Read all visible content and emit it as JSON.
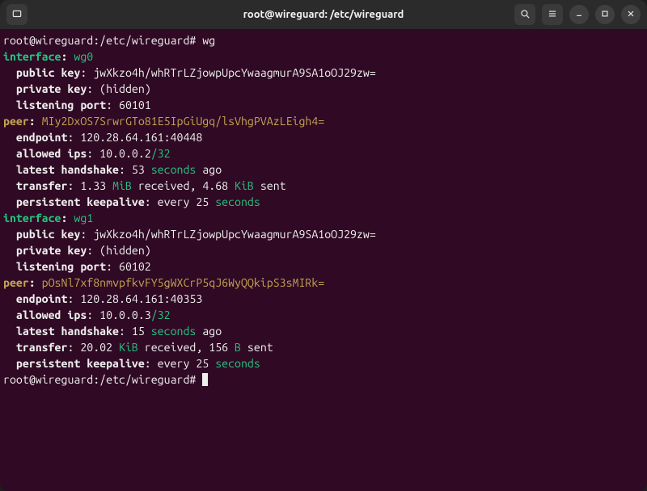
{
  "titlebar": {
    "title": "root@wireguard: /etc/wireguard"
  },
  "term": {
    "prompt": "root@wireguard:/etc/wireguard#",
    "command": "wg",
    "labels": {
      "interface": "interface",
      "peer": "peer",
      "public_key": "public key",
      "private_key": "private key",
      "listening_port": "listening port",
      "endpoint": "endpoint",
      "allowed_ips": "allowed ips",
      "latest_handshake": "latest handshake",
      "transfer": "transfer",
      "persistent_keepalive": "persistent keepalive",
      "received": "received",
      "sent": "sent",
      "ago": "ago",
      "every": "every",
      "hidden": "(hidden)",
      "seconds": "seconds"
    },
    "interfaces": [
      {
        "name": "wg0",
        "public_key": "jwXkzo4h/whRTrLZjowpUpcYwaagmurA9SA1oOJ29zw=",
        "private_key": "(hidden)",
        "listening_port": "60101",
        "peers": [
          {
            "key": "MIy2DxOS7SrwrGTo81E5IpGiUgq/lsVhgPVAzLEigh4=",
            "endpoint": "120.28.64.161:40448",
            "allowed_ip": "10.0.0.2",
            "allowed_ip_mask": "/32",
            "handshake_n": "53",
            "rx_n": "1.33",
            "rx_unit": "MiB",
            "tx_n": "4.68",
            "tx_unit": "KiB",
            "keepalive_n": "25"
          }
        ]
      },
      {
        "name": "wg1",
        "public_key": "jwXkzo4h/whRTrLZjowpUpcYwaagmurA9SA1oOJ29zw=",
        "private_key": "(hidden)",
        "listening_port": "60102",
        "peers": [
          {
            "key": "pOsNl7xf8nmvpfkvFY5gWXCrP5qJ6WyQQkipS3sMIRk=",
            "endpoint": "120.28.64.161:40353",
            "allowed_ip": "10.0.0.3",
            "allowed_ip_mask": "/32",
            "handshake_n": "15",
            "rx_n": "20.02",
            "rx_unit": "KiB",
            "tx_n": "156",
            "tx_unit": "B",
            "keepalive_n": "25"
          }
        ]
      }
    ]
  }
}
